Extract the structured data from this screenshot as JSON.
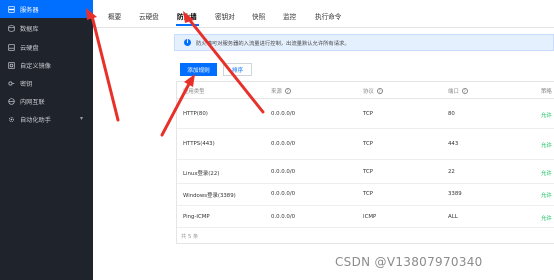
{
  "sidebar": {
    "items": [
      "服务器",
      "数据库",
      "云硬盘",
      "自定义镜像",
      "密钥",
      "内网互联",
      "自动化助手"
    ]
  },
  "tabs": [
    "概要",
    "云硬盘",
    "防火墙",
    "密钥对",
    "快照",
    "监控",
    "执行命令"
  ],
  "notice": "防火墙可对服务器的入流量进行控制，出流量默认允许所有请求。",
  "buttons": {
    "add_rule": "添加规则",
    "sort": "排序"
  },
  "table": {
    "headers": [
      "应用类型",
      "来源",
      "协议",
      "端口",
      "策略"
    ],
    "rows": [
      [
        "HTTP(80)",
        "0.0.0.0/0",
        "TCP",
        "80",
        "允许"
      ],
      [
        "HTTPS(443)",
        "0.0.0.0/0",
        "TCP",
        "443",
        "允许"
      ],
      [
        "Linux登录(22)",
        "0.0.0.0/0",
        "TCP",
        "22",
        "允许"
      ],
      [
        "Windows登录(3389)",
        "0.0.0.0/0",
        "TCP",
        "3389",
        "允许"
      ],
      [
        "Ping-ICMP",
        "0.0.0.0/0",
        "ICMP",
        "ALL",
        "允许"
      ]
    ],
    "footer": "共 5 条"
  },
  "colors": {
    "accent": "#006eff",
    "sidebar_bg": "#1f232b",
    "allow": "#0abf5b",
    "annotation": "#e8302a"
  },
  "watermark": "CSDN @V13807970340"
}
